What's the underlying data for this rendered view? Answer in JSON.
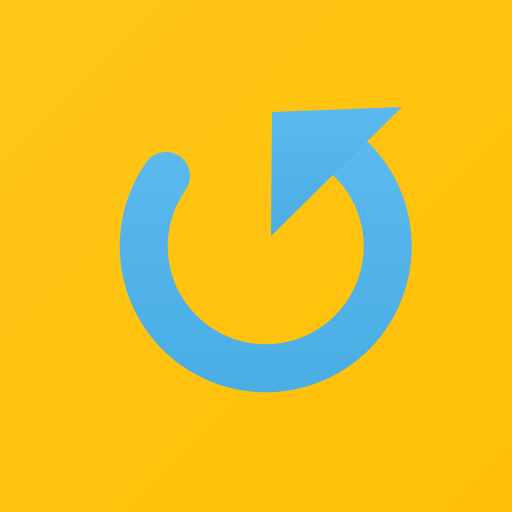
{
  "app_icon": {
    "name": "refresh",
    "icon": "refresh-icon",
    "colors": {
      "background": "#FFC20E",
      "arrow": "#4FB3E8",
      "arrow_highlight": "#5FBDF0"
    }
  }
}
